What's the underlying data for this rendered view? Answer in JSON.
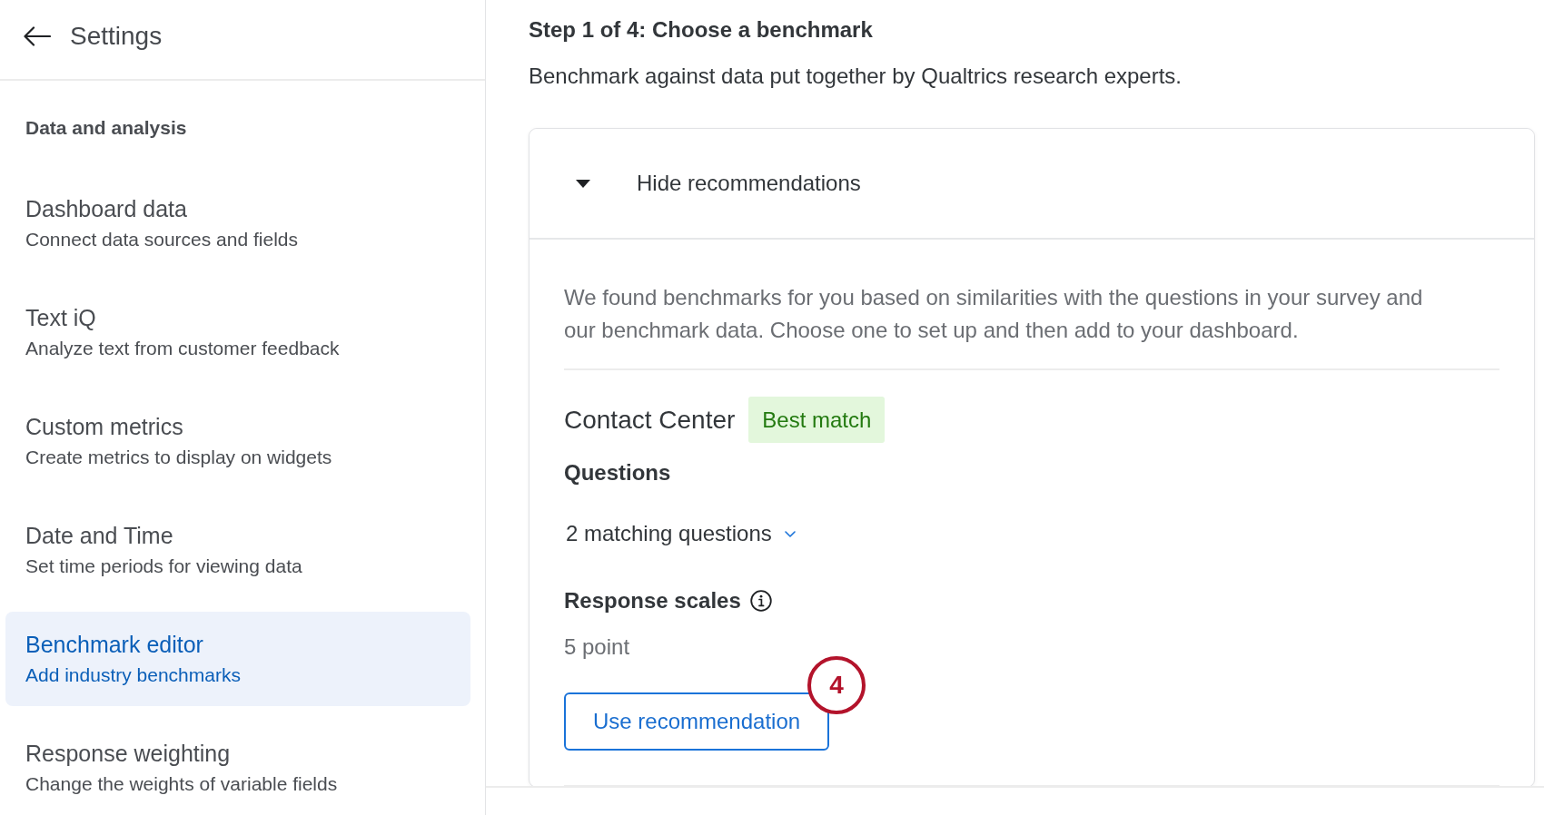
{
  "header": {
    "title": "Settings"
  },
  "sidebar": {
    "section": "Data and analysis",
    "items": [
      {
        "title": "Dashboard data",
        "subtitle": "Connect data sources and fields",
        "selected": false
      },
      {
        "title": "Text iQ",
        "subtitle": "Analyze text from customer feedback",
        "selected": false
      },
      {
        "title": "Custom metrics",
        "subtitle": "Create metrics to display on widgets",
        "selected": false
      },
      {
        "title": "Date and Time",
        "subtitle": "Set time periods for viewing data",
        "selected": false
      },
      {
        "title": "Benchmark editor",
        "subtitle": "Add industry benchmarks",
        "selected": true
      },
      {
        "title": "Response weighting",
        "subtitle": "Change the weights of variable fields",
        "selected": false
      }
    ]
  },
  "main": {
    "step_title": "Step 1 of 4: Choose a benchmark",
    "description": "Benchmark against data put together by Qualtrics research experts.",
    "recommendations": {
      "toggle_label": "Hide recommendations",
      "expanded": true,
      "intro": "We found benchmarks for you based on similarities with the questions in your survey and our benchmark data. Choose one to set up and then add to your dashboard.",
      "benchmark": {
        "name": "Contact Center",
        "badge": "Best match",
        "questions_label": "Questions",
        "matching_questions": "2 matching questions",
        "response_scales_label": "Response scales",
        "response_scale": "5 point",
        "action": "Use recommendation",
        "callout": "4"
      }
    }
  }
}
